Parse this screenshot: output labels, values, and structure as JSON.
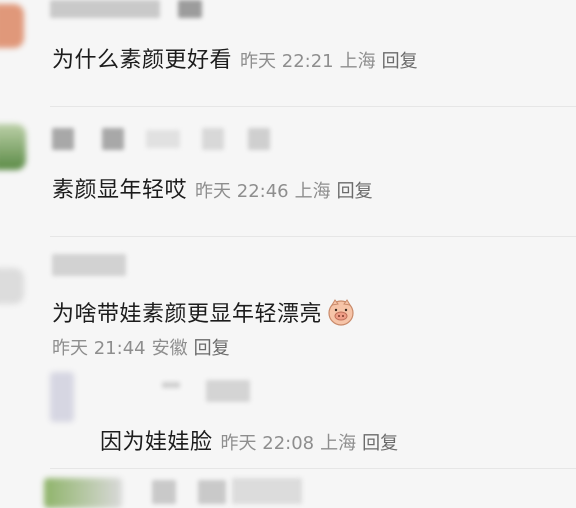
{
  "comments": [
    {
      "text": "为什么素颜更好看",
      "time": "昨天 22:21",
      "location": "上海",
      "reply": "回复"
    },
    {
      "text": "素颜显年轻哎",
      "time": "昨天 22:46",
      "location": "上海",
      "reply": "回复"
    },
    {
      "text": "为啥带娃素颜更显年轻漂亮",
      "emoji": "pig-face-emoji",
      "time": "昨天 21:44",
      "location": "安徽",
      "reply": "回复"
    },
    {
      "text": "因为娃娃脸",
      "time": "昨天 22:08",
      "location": "上海",
      "reply": "回复"
    }
  ],
  "colors": {
    "background": "#f6f6f6",
    "text": "#1c1c1c",
    "meta": "#8e8e8e",
    "blur_block": "#c9c9c9"
  }
}
